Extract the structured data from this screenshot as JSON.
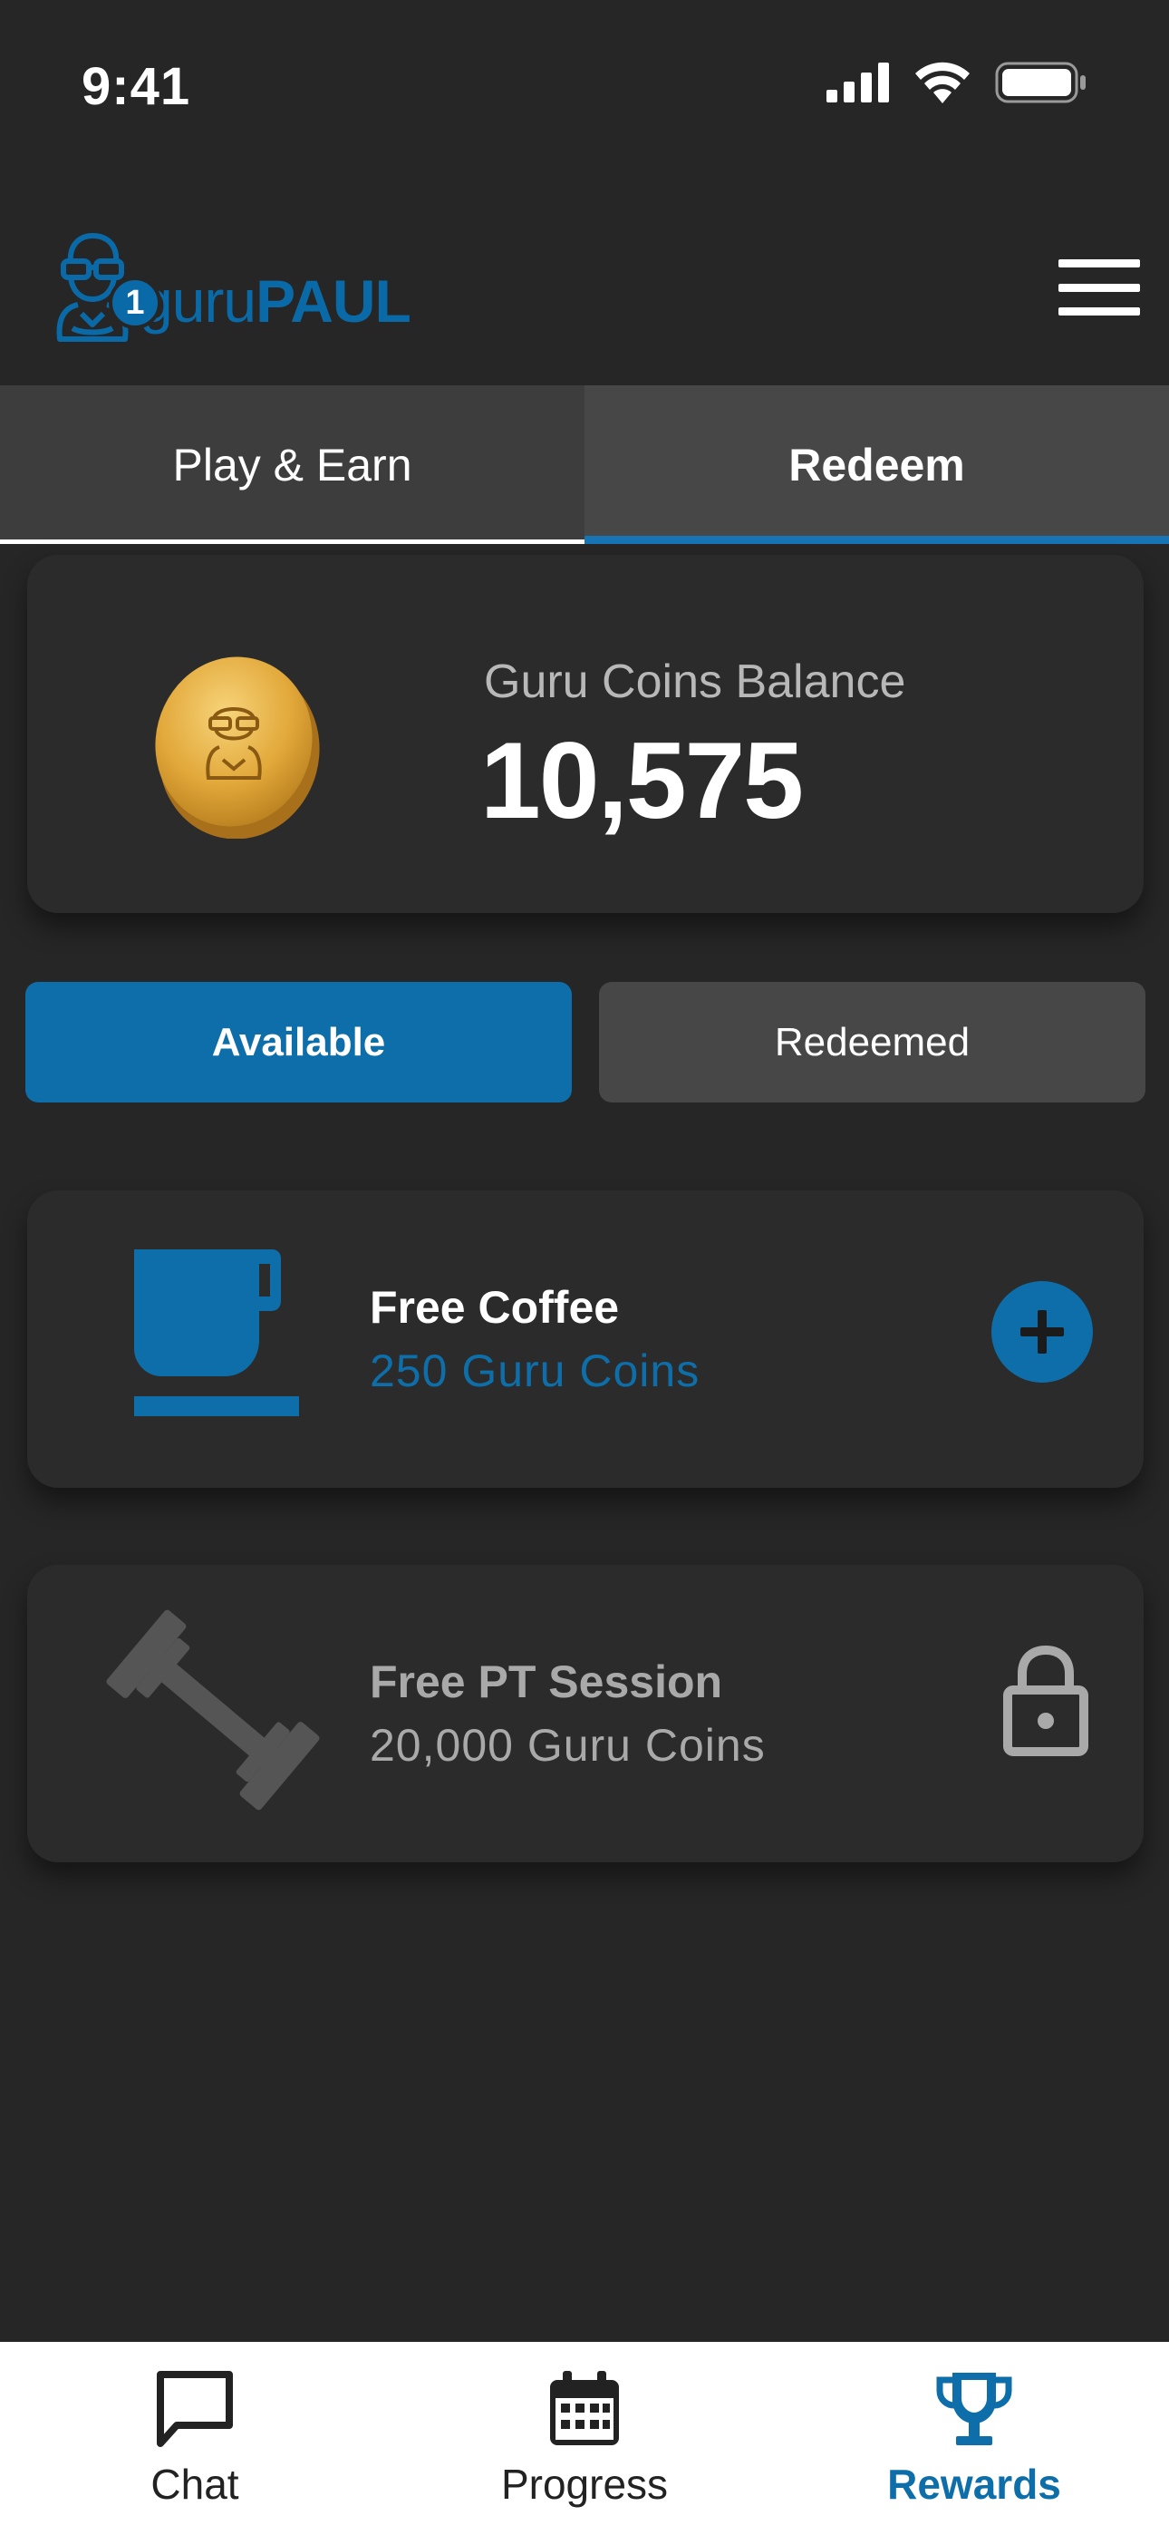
{
  "status_bar": {
    "time": "9:41"
  },
  "header": {
    "logo_text_light": "guru",
    "logo_text_bold": "PAUL",
    "notification_count": "1"
  },
  "tabs": [
    {
      "label": "Play & Earn",
      "active": false
    },
    {
      "label": "Redeem",
      "active": true
    }
  ],
  "balance": {
    "label": "Guru Coins Balance",
    "value": "10,575"
  },
  "filters": {
    "available": "Available",
    "redeemed": "Redeemed"
  },
  "rewards": [
    {
      "title": "Free Coffee",
      "cost": "250 Guru Coins",
      "icon": "coffee-cup-icon",
      "state": "available",
      "action_icon": "plus-icon"
    },
    {
      "title": "Free PT Session",
      "cost": "20,000 Guru Coins",
      "icon": "dumbbell-icon",
      "state": "locked",
      "action_icon": "lock-icon"
    }
  ],
  "bottom_nav": [
    {
      "label": "Chat",
      "icon": "chat-bubble-icon",
      "active": false
    },
    {
      "label": "Progress",
      "icon": "calendar-icon",
      "active": false
    },
    {
      "label": "Rewards",
      "icon": "trophy-icon",
      "active": true
    }
  ],
  "colors": {
    "background": "#262626",
    "accent": "#0e6ea9",
    "card": "#2b2b2b",
    "tab_bar": "#3d3d3d",
    "muted_text": "#a9a9a9",
    "nav_background": "#ffffff"
  }
}
